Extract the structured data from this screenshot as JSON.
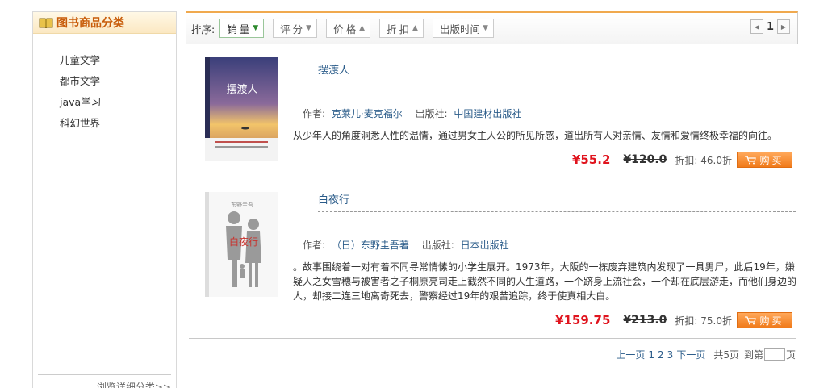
{
  "sidebar": {
    "title": "图书商品分类",
    "categories": [
      "儿童文学",
      "都市文学",
      "java学习",
      "科幻世界"
    ],
    "footer": "浏览详细分类>>"
  },
  "sortbar": {
    "label": "排序:",
    "buttons": [
      "销量",
      "评分",
      "价格",
      "折扣",
      "出版时间"
    ],
    "current_page": "1"
  },
  "products": [
    {
      "title": "摆渡人",
      "author_label": "作者:",
      "author": "克莱儿·麦克福尔",
      "publisher_label": "出版社:",
      "publisher": "中国建材出版社",
      "description": "从少年人的角度洞悉人性的温情，通过男女主人公的所见所感，道出所有人对亲情、友情和爱情终极幸福的向往。",
      "price": "¥55.2",
      "old_price": "¥120.0",
      "discount": "折扣: 46.0折",
      "buy_label": "购买"
    },
    {
      "title": "白夜行",
      "author_label": "作者:",
      "author": "（日）东野圭吾著",
      "publisher_label": "出版社:",
      "publisher": "日本出版社",
      "description": "。故事围绕着一对有着不同寻常情愫的小学生展开。1973年，大阪的一栋废弃建筑内发现了一具男尸，此后19年，嫌疑人之女雪穗与被害者之子桐原亮司走上截然不同的人生道路，一个跻身上流社会，一个却在底层游走，而他们身边的人，却接二连三地离奇死去，警察经过19年的艰苦追踪，终于使真相大白。",
      "price": "¥159.75",
      "old_price": "¥213.0",
      "discount": "折扣: 75.0折",
      "buy_label": "购买"
    }
  ],
  "covers": [
    {
      "text": "摆渡人"
    },
    {
      "text": "白夜行",
      "author": "东野圭吾"
    }
  ],
  "pager": {
    "prev": "上一页",
    "pages": [
      "1",
      "2",
      "3"
    ],
    "next": "下一页",
    "total": "共5页",
    "goto_prefix": "到第",
    "goto_suffix": "页"
  }
}
